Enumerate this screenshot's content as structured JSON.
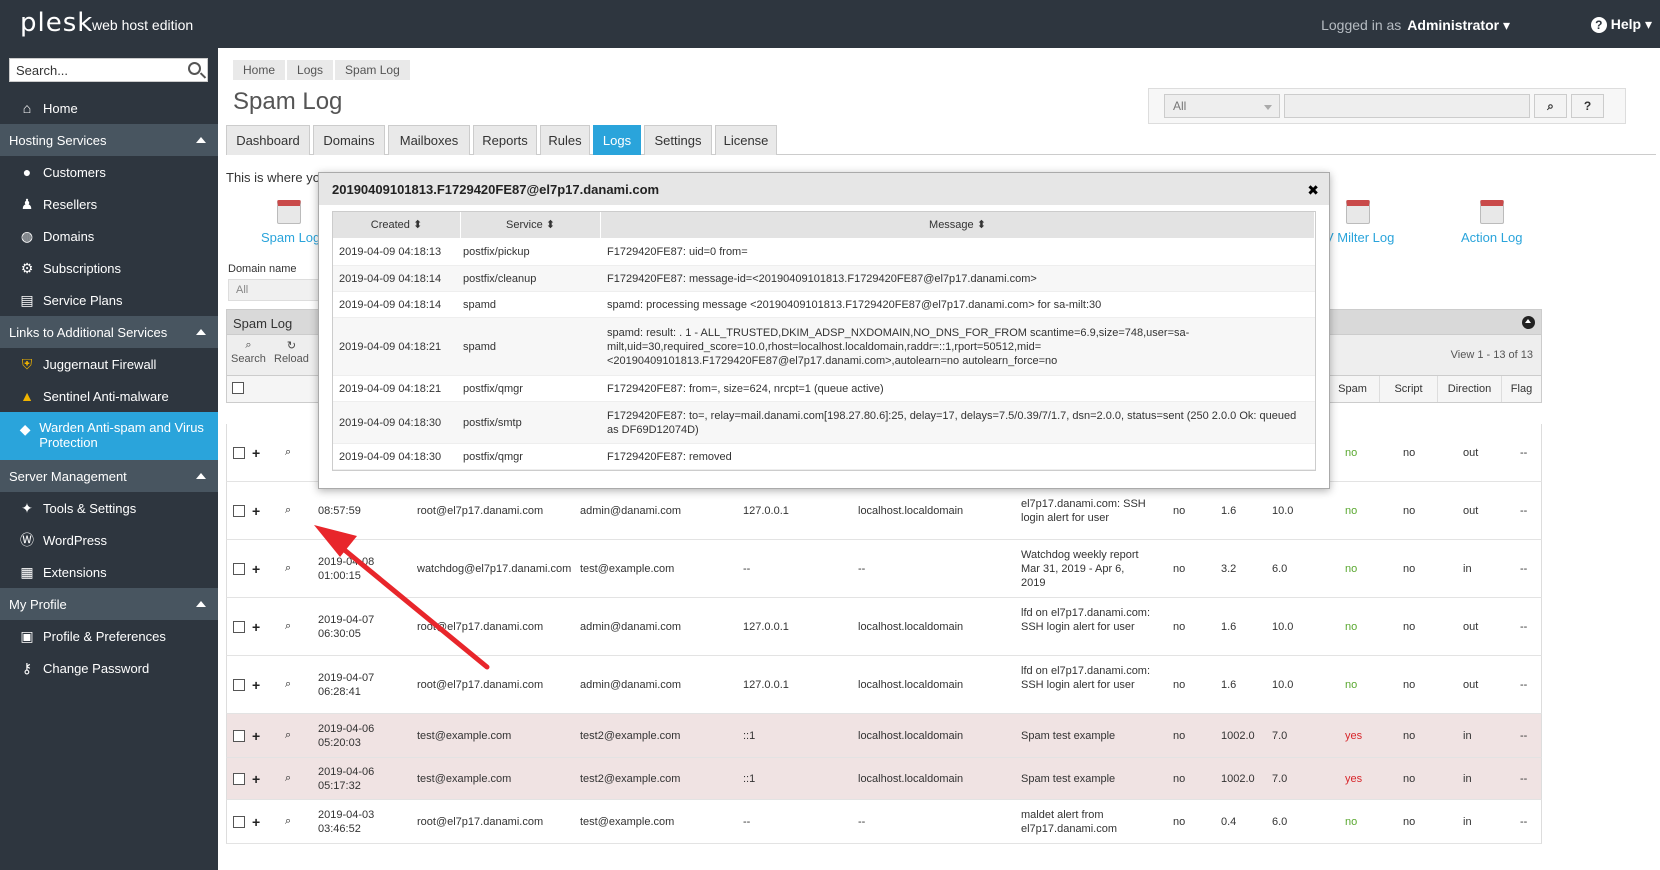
{
  "top": {
    "logo": "plesk",
    "edition": "web host edition",
    "logged_in_as": "Logged in as",
    "user": "Administrator ▾",
    "help": "Help ▾"
  },
  "sidebar": {
    "search_placeholder": "Search...",
    "home": "Home",
    "hosting_services": "Hosting Services",
    "customers": "Customers",
    "resellers": "Resellers",
    "domains": "Domains",
    "subscriptions": "Subscriptions",
    "service_plans": "Service Plans",
    "links_additional": "Links to Additional Services",
    "juggernaut": "Juggernaut Firewall",
    "sentinel": "Sentinel Anti-malware",
    "warden": "Warden Anti-spam and Virus Protection",
    "server_management": "Server Management",
    "tools_settings": "Tools & Settings",
    "wordpress": "WordPress",
    "extensions": "Extensions",
    "my_profile": "My Profile",
    "profile_prefs": "Profile & Preferences",
    "change_password": "Change Password"
  },
  "breadcrumb": [
    "Home",
    "Logs",
    "Spam Log"
  ],
  "page_title": "Spam Log",
  "filter": {
    "select_value": "All",
    "search_btn": "⌕",
    "help_btn": "?"
  },
  "tabs": [
    "Dashboard",
    "Domains",
    "Mailboxes",
    "Reports",
    "Rules",
    "Logs",
    "Settings",
    "License"
  ],
  "description": "This is where yo",
  "tools": {
    "spam_log": "Spam Log",
    "milter_log": "V Milter Log",
    "action_log": "Action Log"
  },
  "domain_name_label": "Domain name",
  "domain_name_value": "All",
  "panel": {
    "title": "Spam Log",
    "search": "Search",
    "reload": "Reload",
    "view_count": "View 1 - 13 of 13"
  },
  "table_headers": {
    "spam": "Spam",
    "script": "Script",
    "direction": "Direction",
    "flag": "Flag"
  },
  "rows": [
    {
      "date": "",
      "time": "",
      "from": "",
      "to": "",
      "ip": "",
      "host": "",
      "subject": "",
      "c1": "",
      "c2": "",
      "c3": "",
      "spam": "no",
      "script": "no",
      "dir": "out",
      "flag": "--"
    },
    {
      "date": "",
      "time": "08:57:59",
      "from": "root@el7p17.danami.com",
      "to": "admin@danami.com",
      "ip": "127.0.0.1",
      "host": "localhost.localdomain",
      "subject": "el7p17.danami.com: SSH login alert for user",
      "c1": "no",
      "c2": "1.6",
      "c3": "10.0",
      "spam": "no",
      "script": "no",
      "dir": "out",
      "flag": "--"
    },
    {
      "date": "2019-04-08",
      "time": "01:00:15",
      "from": "watchdog@el7p17.danami.com",
      "to": "test@example.com",
      "ip": "--",
      "host": "--",
      "subject": "Watchdog weekly report Mar 31, 2019 - Apr 6, 2019",
      "c1": "no",
      "c2": "3.2",
      "c3": "6.0",
      "spam": "no",
      "script": "no",
      "dir": "in",
      "flag": "--"
    },
    {
      "date": "2019-04-07",
      "time": "06:30:05",
      "from": "root@el7p17.danami.com",
      "to": "admin@danami.com",
      "ip": "127.0.0.1",
      "host": "localhost.localdomain",
      "subject": "lfd on el7p17.danami.com: SSH login alert for user",
      "c1": "no",
      "c2": "1.6",
      "c3": "10.0",
      "spam": "no",
      "script": "no",
      "dir": "out",
      "flag": "--"
    },
    {
      "date": "2019-04-07",
      "time": "06:28:41",
      "from": "root@el7p17.danami.com",
      "to": "admin@danami.com",
      "ip": "127.0.0.1",
      "host": "localhost.localdomain",
      "subject": "lfd on el7p17.danami.com: SSH login alert for user",
      "c1": "no",
      "c2": "1.6",
      "c3": "10.0",
      "spam": "no",
      "script": "no",
      "dir": "out",
      "flag": "--"
    },
    {
      "date": "2019-04-06",
      "time": "05:20:03",
      "from": "test@example.com",
      "to": "test2@example.com",
      "ip": "::1",
      "host": "localhost.localdomain",
      "subject": "Spam test example",
      "c1": "no",
      "c2": "1002.0",
      "c3": "7.0",
      "spam": "yes",
      "script": "no",
      "dir": "in",
      "flag": "--"
    },
    {
      "date": "2019-04-06",
      "time": "05:17:32",
      "from": "test@example.com",
      "to": "test2@example.com",
      "ip": "::1",
      "host": "localhost.localdomain",
      "subject": "Spam test example",
      "c1": "no",
      "c2": "1002.0",
      "c3": "7.0",
      "spam": "yes",
      "script": "no",
      "dir": "in",
      "flag": "--"
    },
    {
      "date": "2019-04-03",
      "time": "03:46:52",
      "from": "root@el7p17.danami.com",
      "to": "test@example.com",
      "ip": "--",
      "host": "--",
      "subject": "maldet alert from el7p17.danami.com",
      "c1": "no",
      "c2": "0.4",
      "c3": "6.0",
      "spam": "no",
      "script": "no",
      "dir": "in",
      "flag": "--"
    }
  ],
  "modal": {
    "title": "20190409101813.F1729420FE87@el7p17.danami.com",
    "close": "✖",
    "headers": [
      "Created",
      "Service",
      "Message"
    ],
    "rows": [
      {
        "created": "2019-04-09 04:18:13",
        "service": "postfix/pickup",
        "message": "F1729420FE87: uid=0 from="
      },
      {
        "created": "2019-04-09 04:18:14",
        "service": "postfix/cleanup",
        "message": "F1729420FE87: message-id=<20190409101813.F1729420FE87@el7p17.danami.com>"
      },
      {
        "created": "2019-04-09 04:18:14",
        "service": "spamd",
        "message": "spamd: processing message <20190409101813.F1729420FE87@el7p17.danami.com> for sa-milt:30"
      },
      {
        "created": "2019-04-09 04:18:21",
        "service": "spamd",
        "message": "spamd: result: . 1 - ALL_TRUSTED,DKIM_ADSP_NXDOMAIN,NO_DNS_FOR_FROM scantime=6.9,size=748,user=sa-milt,uid=30,required_score=10.0,rhost=localhost.localdomain,raddr=::1,rport=50512,mid=<20190409101813.F1729420FE87@el7p17.danami.com>,autolearn=no autolearn_force=no"
      },
      {
        "created": "2019-04-09 04:18:21",
        "service": "postfix/qmgr",
        "message": "F1729420FE87: from=, size=624, nrcpt=1 (queue active)"
      },
      {
        "created": "2019-04-09 04:18:30",
        "service": "postfix/smtp",
        "message": "F1729420FE87: to=, relay=mail.danami.com[198.27.80.6]:25, delay=17, delays=7.5/0.39/7/1.7, dsn=2.0.0, status=sent (250 2.0.0 Ok: queued as DF69D12074D)"
      },
      {
        "created": "2019-04-09 04:18:30",
        "service": "postfix/qmgr",
        "message": "F1729420FE87: removed"
      }
    ]
  },
  "colors": {
    "sidebar_bg": "#2e363f",
    "accent": "#2aa4db",
    "spam_row": "#f0e3e3",
    "arrow": "#e8262b"
  }
}
